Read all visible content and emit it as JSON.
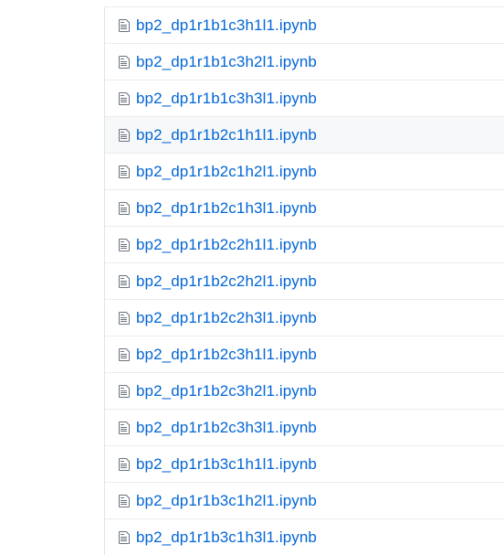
{
  "colors": {
    "link": "#0366d6",
    "icon": "#6a737d",
    "border": "#eaecef",
    "row_hover_background": "#f6f8fa"
  },
  "file_list": {
    "icon_name": "file-text-icon",
    "hovered_index": 3,
    "items": [
      {
        "name": "bp2_dp1r1b1c3h1l1.ipynb"
      },
      {
        "name": "bp2_dp1r1b1c3h2l1.ipynb"
      },
      {
        "name": "bp2_dp1r1b1c3h3l1.ipynb"
      },
      {
        "name": "bp2_dp1r1b2c1h1l1.ipynb"
      },
      {
        "name": "bp2_dp1r1b2c1h2l1.ipynb"
      },
      {
        "name": "bp2_dp1r1b2c1h3l1.ipynb"
      },
      {
        "name": "bp2_dp1r1b2c2h1l1.ipynb"
      },
      {
        "name": "bp2_dp1r1b2c2h2l1.ipynb"
      },
      {
        "name": "bp2_dp1r1b2c2h3l1.ipynb"
      },
      {
        "name": "bp2_dp1r1b2c3h1l1.ipynb"
      },
      {
        "name": "bp2_dp1r1b2c3h2l1.ipynb"
      },
      {
        "name": "bp2_dp1r1b2c3h3l1.ipynb"
      },
      {
        "name": "bp2_dp1r1b3c1h1l1.ipynb"
      },
      {
        "name": "bp2_dp1r1b3c1h2l1.ipynb"
      },
      {
        "name": "bp2_dp1r1b3c1h3l1.ipynb"
      }
    ]
  }
}
